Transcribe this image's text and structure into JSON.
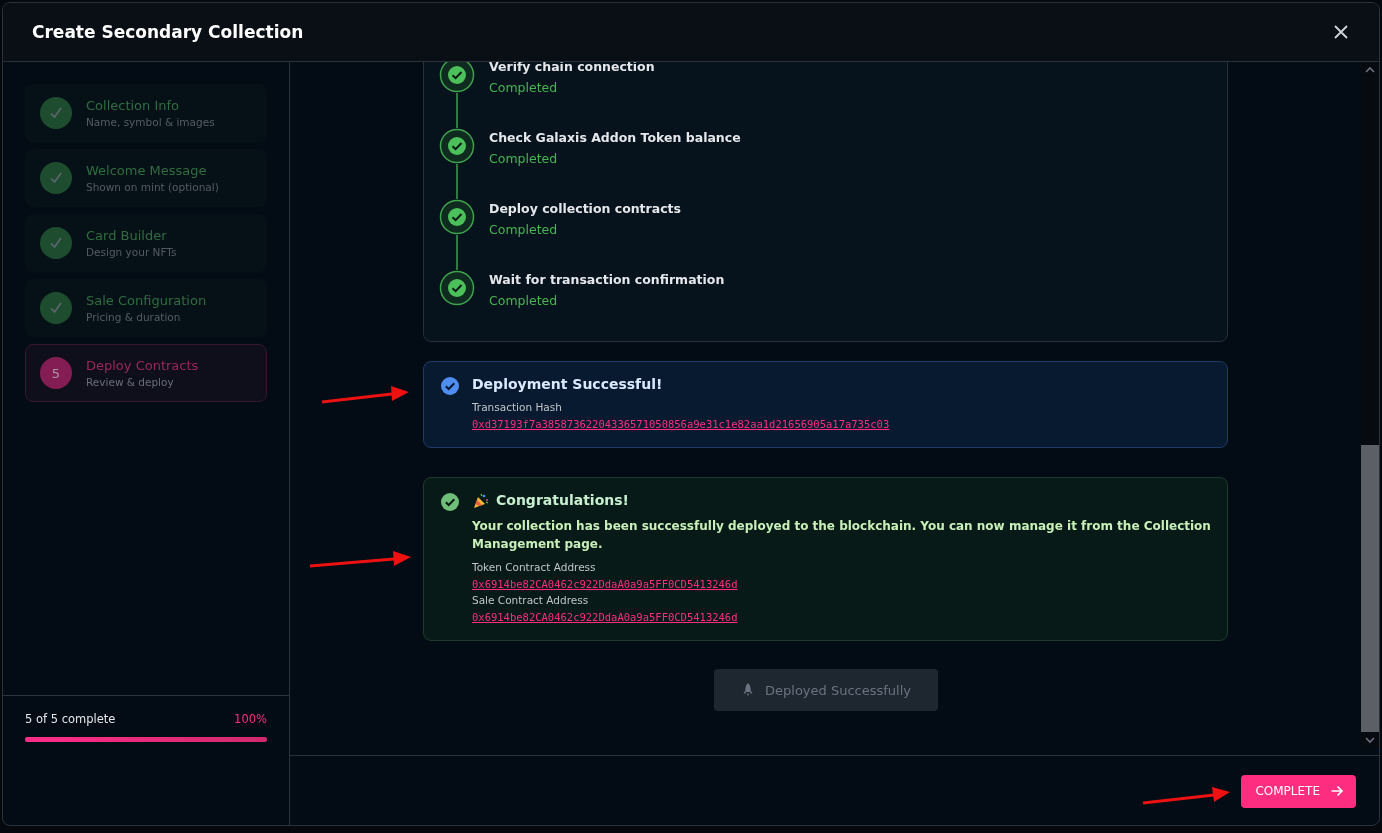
{
  "dialog": {
    "title": "Create Secondary Collection"
  },
  "steps": [
    {
      "title": "Collection Info",
      "subtitle": "Name, symbol & images",
      "completed": true,
      "selected": false
    },
    {
      "title": "Welcome Message",
      "subtitle": "Shown on mint (optional)",
      "completed": true,
      "selected": false
    },
    {
      "title": "Card Builder",
      "subtitle": "Design your NFTs",
      "completed": true,
      "selected": false
    },
    {
      "title": "Sale Configuration",
      "subtitle": "Pricing & duration",
      "completed": true,
      "selected": false
    },
    {
      "title": "Deploy Contracts",
      "subtitle": "Review & deploy",
      "completed": false,
      "selected": true,
      "number": "5"
    }
  ],
  "progress": {
    "label": "5 of 5 complete",
    "percent": "100%",
    "level": 1
  },
  "checklist": [
    {
      "title": "Verify chain connection",
      "status": "Completed",
      "done": true
    },
    {
      "title": "Check Galaxis Addon Token balance",
      "status": "Completed",
      "done": true
    },
    {
      "title": "Deploy collection contracts",
      "status": "Completed",
      "done": true
    },
    {
      "title": "Wait for transaction confirmation",
      "status": "Completed",
      "done": true
    }
  ],
  "deployment": {
    "title": "Deployment Successful!",
    "hash_label": "Transaction Hash",
    "hash": "0xd37193f7a38587362204336571050856a9e31c1e82aa1d21656905a17a735c03"
  },
  "congrats": {
    "title": "Congratulations!",
    "message": "Your collection has been successfully deployed to the blockchain. You can now manage it from the Collection Management page.",
    "addresses": [
      {
        "label": "Token Contract Address",
        "value": "0x6914be82CA0462c922DdaA0a9a5FF0CD5413246d"
      },
      {
        "label": "Sale Contract Address",
        "value": "0x6914be82CA0462c922DdaA0a9a5FF0CD5413246d"
      }
    ]
  },
  "deploy_button": {
    "label": "Deployed Successfully",
    "disabled": true
  },
  "complete_button": {
    "label": "COMPLETE"
  }
}
